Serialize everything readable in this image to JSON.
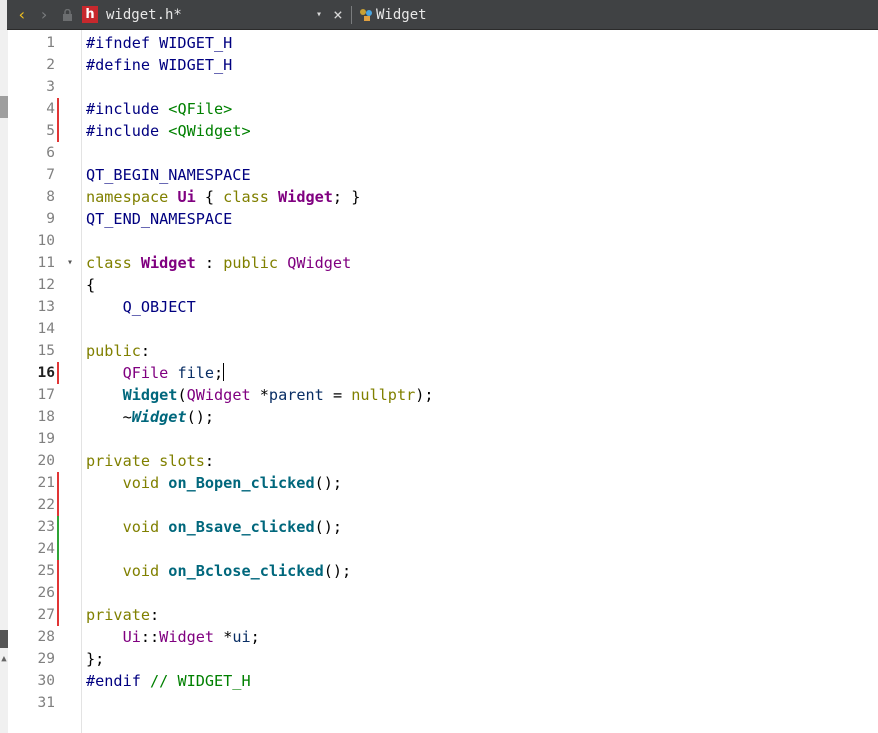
{
  "toolbar": {
    "back_icon": "chevron-left-icon",
    "forward_icon": "chevron-right-icon",
    "file_badge": "h",
    "file_name": "widget.h*",
    "dropdown_glyph": "▾",
    "close_glyph": "×",
    "symbol_name": "Widget"
  },
  "colors": {
    "toolbar_bg": "#404244",
    "file_badge_bg": "#c7282d",
    "change_modified": "#e13535",
    "change_saved": "#2fa336"
  },
  "editor": {
    "current_line": 16,
    "lines": [
      {
        "n": "1",
        "marker": "",
        "fold": "",
        "tokens": [
          {
            "t": "#ifndef WIDGET_H",
            "c": "pre"
          }
        ]
      },
      {
        "n": "2",
        "marker": "",
        "fold": "",
        "tokens": [
          {
            "t": "#define WIDGET_H",
            "c": "pre"
          }
        ]
      },
      {
        "n": "3",
        "marker": "",
        "fold": "",
        "tokens": []
      },
      {
        "n": "4",
        "marker": "red",
        "fold": "",
        "tokens": [
          {
            "t": "#include ",
            "c": "pre"
          },
          {
            "t": "<QFile>",
            "c": "str"
          }
        ]
      },
      {
        "n": "5",
        "marker": "red",
        "fold": "",
        "tokens": [
          {
            "t": "#include ",
            "c": "pre"
          },
          {
            "t": "<QWidget>",
            "c": "str"
          }
        ]
      },
      {
        "n": "6",
        "marker": "",
        "fold": "",
        "tokens": []
      },
      {
        "n": "7",
        "marker": "",
        "fold": "",
        "tokens": [
          {
            "t": "QT_BEGIN_NAMESPACE",
            "c": "macro"
          }
        ]
      },
      {
        "n": "8",
        "marker": "",
        "fold": "",
        "tokens": [
          {
            "t": "namespace ",
            "c": "kw"
          },
          {
            "t": "Ui",
            "c": "typeb"
          },
          {
            "t": " { ",
            "c": "plain"
          },
          {
            "t": "class ",
            "c": "kw"
          },
          {
            "t": "Widget",
            "c": "typeb"
          },
          {
            "t": "; }",
            "c": "plain"
          }
        ]
      },
      {
        "n": "9",
        "marker": "",
        "fold": "",
        "tokens": [
          {
            "t": "QT_END_NAMESPACE",
            "c": "macro"
          }
        ]
      },
      {
        "n": "10",
        "marker": "",
        "fold": "",
        "tokens": []
      },
      {
        "n": "11",
        "marker": "",
        "fold": "▾",
        "tokens": [
          {
            "t": "class ",
            "c": "kw"
          },
          {
            "t": "Widget",
            "c": "typeb"
          },
          {
            "t": " : ",
            "c": "plain"
          },
          {
            "t": "public ",
            "c": "kw"
          },
          {
            "t": "QWidget",
            "c": "type"
          }
        ]
      },
      {
        "n": "12",
        "marker": "",
        "fold": "",
        "tokens": [
          {
            "t": "{",
            "c": "plain"
          }
        ]
      },
      {
        "n": "13",
        "marker": "",
        "fold": "",
        "tokens": [
          {
            "t": "    Q_OBJECT",
            "c": "macro"
          }
        ]
      },
      {
        "n": "14",
        "marker": "",
        "fold": "",
        "tokens": []
      },
      {
        "n": "15",
        "marker": "",
        "fold": "",
        "tokens": [
          {
            "t": "public",
            "c": "kw"
          },
          {
            "t": ":",
            "c": "plain"
          }
        ]
      },
      {
        "n": "16",
        "marker": "red",
        "fold": "",
        "tokens": [
          {
            "t": "    ",
            "c": "plain"
          },
          {
            "t": "QFile",
            "c": "type"
          },
          {
            "t": " ",
            "c": "plain"
          },
          {
            "t": "file",
            "c": "var"
          },
          {
            "t": ";",
            "c": "plain"
          }
        ],
        "cursor": true
      },
      {
        "n": "17",
        "marker": "",
        "fold": "",
        "tokens": [
          {
            "t": "    ",
            "c": "plain"
          },
          {
            "t": "Widget",
            "c": "fn"
          },
          {
            "t": "(",
            "c": "plain"
          },
          {
            "t": "QWidget",
            "c": "type"
          },
          {
            "t": " *",
            "c": "plain"
          },
          {
            "t": "parent",
            "c": "var"
          },
          {
            "t": " = ",
            "c": "plain"
          },
          {
            "t": "nullptr",
            "c": "kw"
          },
          {
            "t": ");",
            "c": "plain"
          }
        ]
      },
      {
        "n": "18",
        "marker": "",
        "fold": "",
        "tokens": [
          {
            "t": "    ~",
            "c": "plain"
          },
          {
            "t": "Widget",
            "c": "fni"
          },
          {
            "t": "();",
            "c": "plain"
          }
        ]
      },
      {
        "n": "19",
        "marker": "",
        "fold": "",
        "tokens": []
      },
      {
        "n": "20",
        "marker": "",
        "fold": "",
        "tokens": [
          {
            "t": "private ",
            "c": "kw"
          },
          {
            "t": "slots",
            "c": "kw"
          },
          {
            "t": ":",
            "c": "plain"
          }
        ]
      },
      {
        "n": "21",
        "marker": "red",
        "fold": "",
        "tokens": [
          {
            "t": "    ",
            "c": "plain"
          },
          {
            "t": "void ",
            "c": "kw"
          },
          {
            "t": "on_Bopen_clicked",
            "c": "fn"
          },
          {
            "t": "();",
            "c": "plain"
          }
        ]
      },
      {
        "n": "22",
        "marker": "red",
        "fold": "",
        "tokens": []
      },
      {
        "n": "23",
        "marker": "green",
        "fold": "",
        "tokens": [
          {
            "t": "    ",
            "c": "plain"
          },
          {
            "t": "void ",
            "c": "kw"
          },
          {
            "t": "on_Bsave_clicked",
            "c": "fn"
          },
          {
            "t": "();",
            "c": "plain"
          }
        ]
      },
      {
        "n": "24",
        "marker": "green",
        "fold": "",
        "tokens": []
      },
      {
        "n": "25",
        "marker": "red",
        "fold": "",
        "tokens": [
          {
            "t": "    ",
            "c": "plain"
          },
          {
            "t": "void ",
            "c": "kw"
          },
          {
            "t": "on_Bclose_clicked",
            "c": "fn"
          },
          {
            "t": "();",
            "c": "plain"
          }
        ]
      },
      {
        "n": "26",
        "marker": "red",
        "fold": "",
        "tokens": []
      },
      {
        "n": "27",
        "marker": "red",
        "fold": "",
        "tokens": [
          {
            "t": "private",
            "c": "kw"
          },
          {
            "t": ":",
            "c": "plain"
          }
        ]
      },
      {
        "n": "28",
        "marker": "",
        "fold": "",
        "tokens": [
          {
            "t": "    ",
            "c": "plain"
          },
          {
            "t": "Ui",
            "c": "type"
          },
          {
            "t": "::",
            "c": "plain"
          },
          {
            "t": "Widget",
            "c": "type"
          },
          {
            "t": " *",
            "c": "plain"
          },
          {
            "t": "ui",
            "c": "var"
          },
          {
            "t": ";",
            "c": "plain"
          }
        ]
      },
      {
        "n": "29",
        "marker": "",
        "fold": "",
        "tokens": [
          {
            "t": "};",
            "c": "plain"
          }
        ]
      },
      {
        "n": "30",
        "marker": "",
        "fold": "",
        "tokens": [
          {
            "t": "#endif ",
            "c": "pre"
          },
          {
            "t": "// WIDGET_H",
            "c": "cmt"
          }
        ]
      },
      {
        "n": "31",
        "marker": "",
        "fold": "",
        "tokens": []
      }
    ]
  }
}
